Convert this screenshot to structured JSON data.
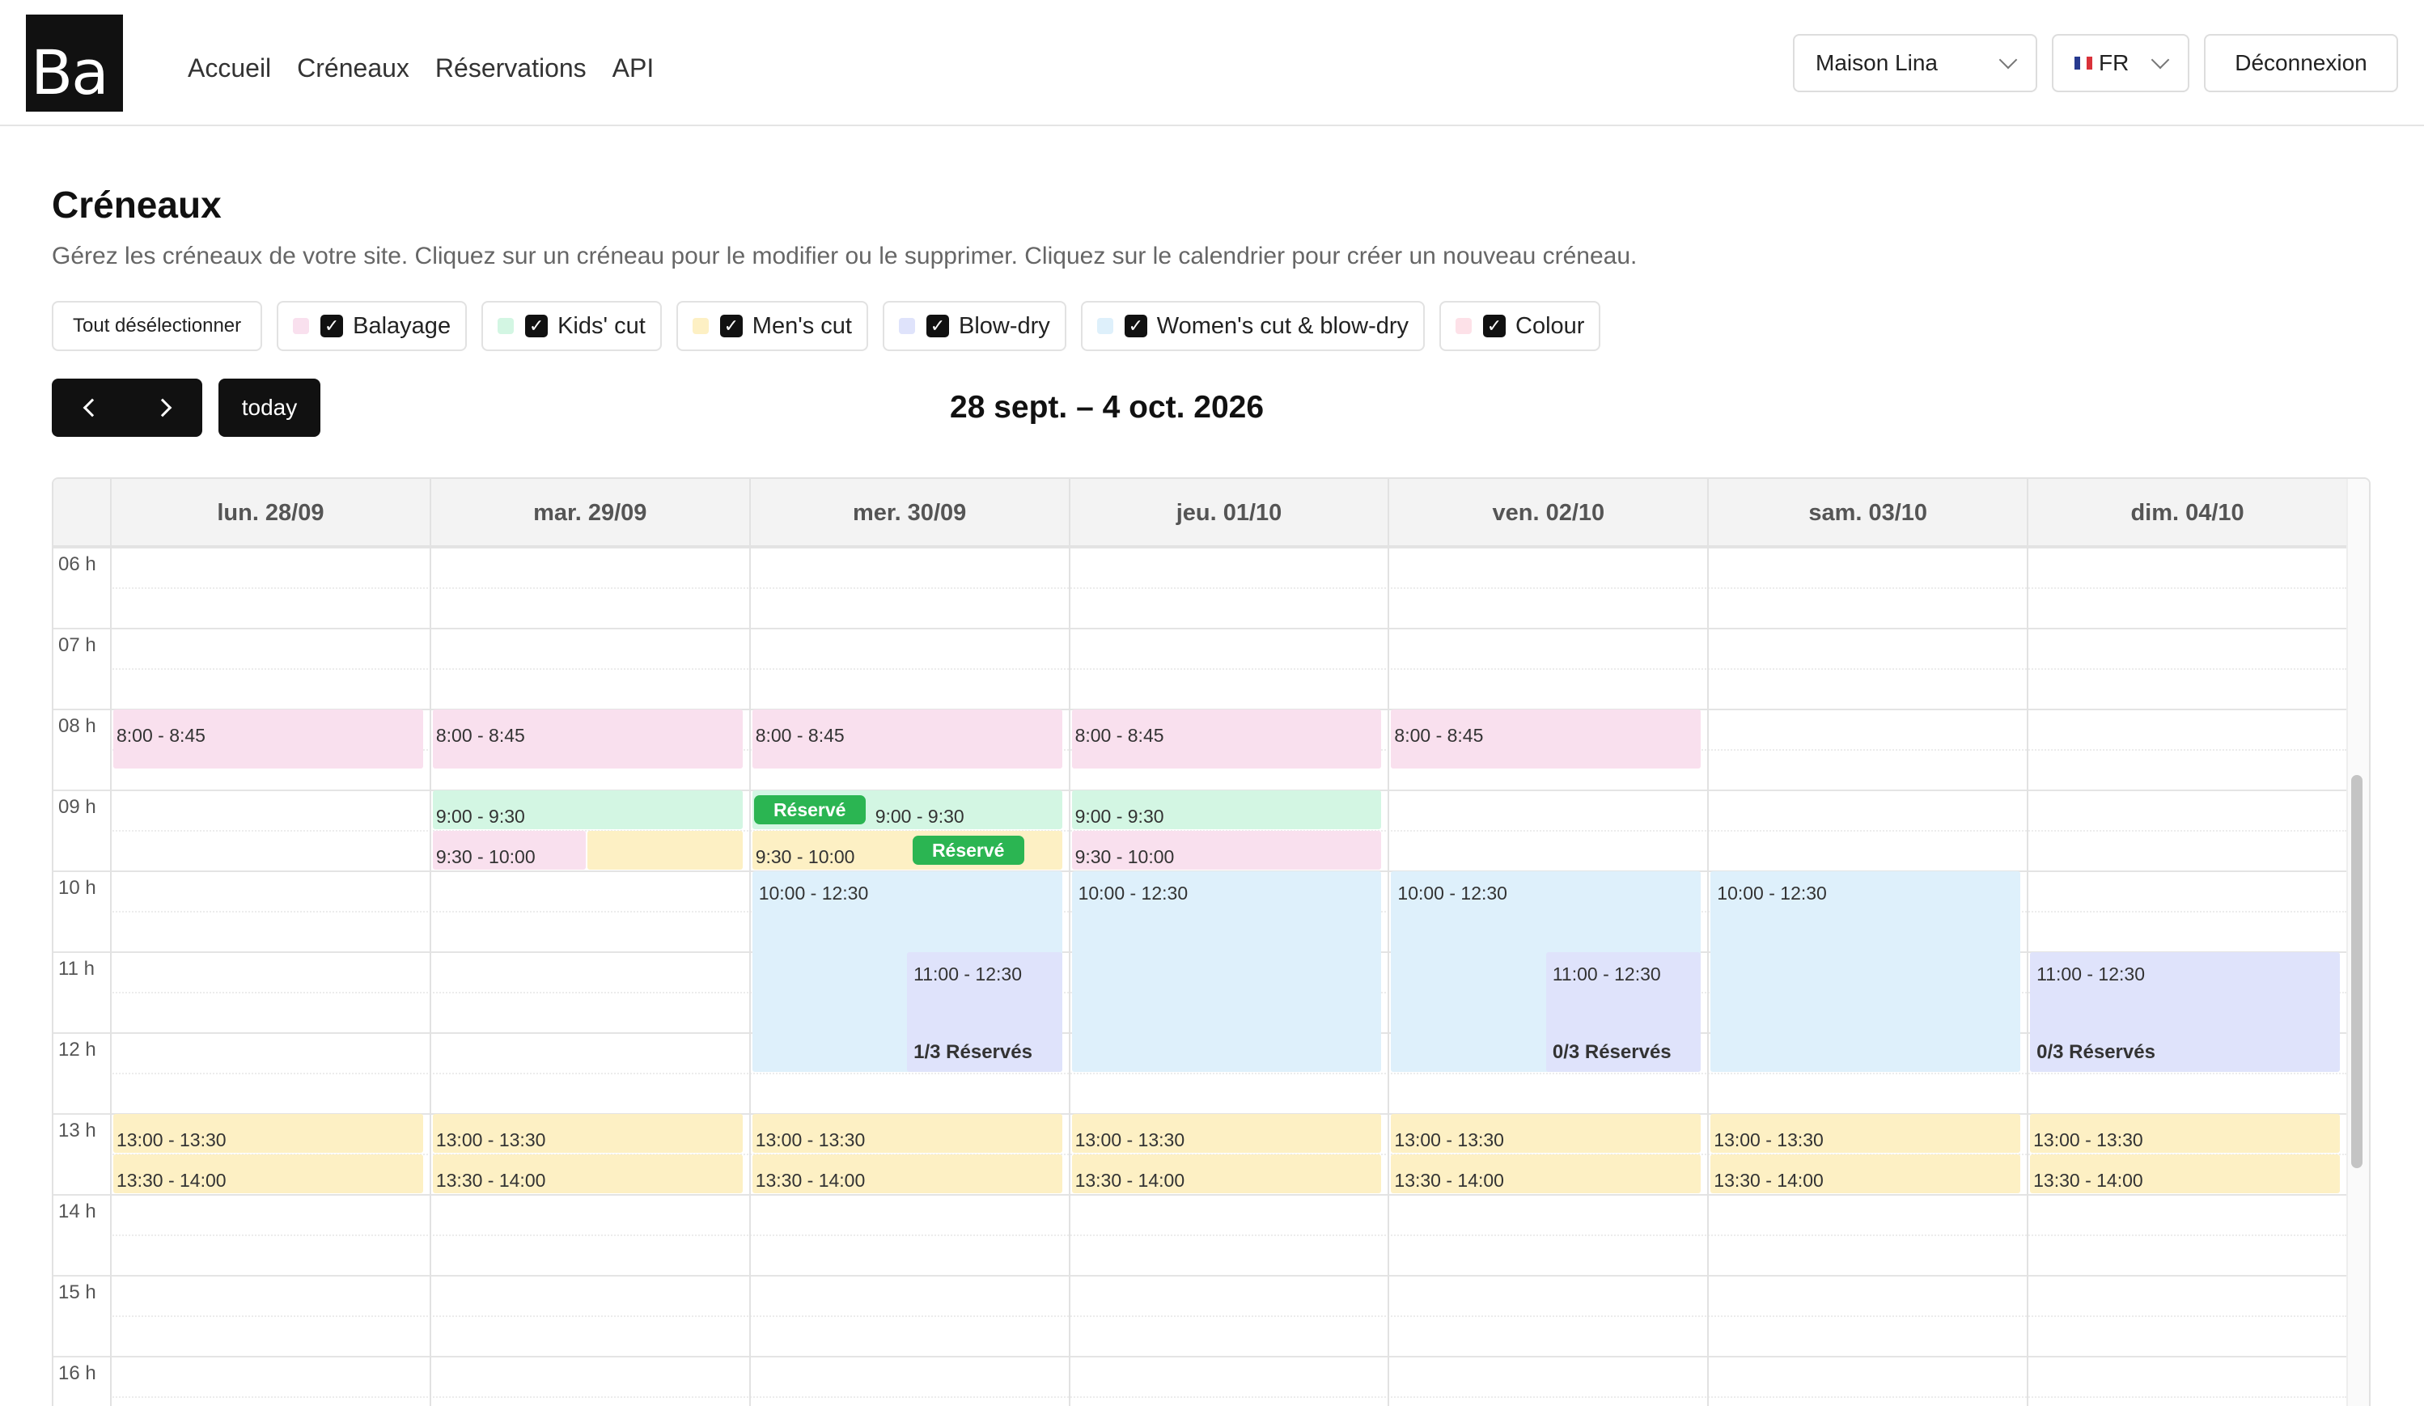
{
  "logo": "Ba",
  "nav": [
    "Accueil",
    "Créneaux",
    "Réservations",
    "API"
  ],
  "header": {
    "site_select": "Maison Lina",
    "lang_select": "FR",
    "logout": "Déconnexion"
  },
  "page": {
    "title": "Créneaux",
    "description": "Gérez les créneaux de votre site. Cliquez sur un créneau pour le modifier ou le supprimer. Cliquez sur le calendrier pour créer un nouveau créneau."
  },
  "filters": {
    "deselect_all": "Tout désélectionner",
    "items": [
      {
        "label": "Balayage",
        "color": "#f9e0ee",
        "checked": true
      },
      {
        "label": "Kids' cut",
        "color": "#d3f6e3",
        "checked": true
      },
      {
        "label": "Men's cut",
        "color": "#fdf0c4",
        "checked": true
      },
      {
        "label": "Blow-dry",
        "color": "#dfe3fb",
        "checked": true
      },
      {
        "label": "Women's cut & blow-dry",
        "color": "#def0fb",
        "checked": true
      },
      {
        "label": "Colour",
        "color": "#fde1e8",
        "checked": true
      }
    ]
  },
  "toolbar": {
    "today": "today",
    "range": "28 sept. – 4 oct. 2026"
  },
  "calendar": {
    "days": [
      "lun. 28/09",
      "mar. 29/09",
      "mer. 30/09",
      "jeu. 01/10",
      "ven. 02/10",
      "sam. 03/10",
      "dim. 04/10"
    ],
    "hours": [
      "06 h",
      "07 h",
      "08 h",
      "09 h",
      "10 h",
      "11 h",
      "12 h",
      "13 h",
      "14 h",
      "15 h",
      "16 h"
    ],
    "events": [
      {
        "day": 0,
        "start": 8,
        "end": 8.75,
        "label": "8:00 - 8:45",
        "type": "balayage"
      },
      {
        "day": 1,
        "start": 8,
        "end": 8.75,
        "label": "8:00 - 8:45",
        "type": "balayage"
      },
      {
        "day": 2,
        "start": 8,
        "end": 8.75,
        "label": "8:00 - 8:45",
        "type": "balayage"
      },
      {
        "day": 3,
        "start": 8,
        "end": 8.75,
        "label": "8:00 - 8:45",
        "type": "balayage"
      },
      {
        "day": 4,
        "start": 8,
        "end": 8.75,
        "label": "8:00 - 8:45",
        "type": "balayage"
      },
      {
        "day": 1,
        "start": 9,
        "end": 9.5,
        "label": "9:00 - 9:30",
        "type": "kids"
      },
      {
        "day": 1,
        "start": 9.5,
        "end": 10,
        "label": "9:30 - 10:00",
        "type": "balayage",
        "col": 0,
        "cols": 2
      },
      {
        "day": 1,
        "start": 9.5,
        "end": 10,
        "label": "",
        "type": "mens",
        "col": 1,
        "cols": 2
      },
      {
        "day": 2,
        "start": 9,
        "end": 9.5,
        "label": "9:00 - 9:30",
        "type": "kids",
        "badge": "Réservé"
      },
      {
        "day": 2,
        "start": 9.5,
        "end": 10,
        "label": "9:30 - 10:00",
        "type": "mens",
        "badge": "Réservé"
      },
      {
        "day": 3,
        "start": 9,
        "end": 9.5,
        "label": "9:00 - 9:30",
        "type": "kids"
      },
      {
        "day": 3,
        "start": 9.5,
        "end": 10,
        "label": "9:30 - 10:00",
        "type": "balayage"
      },
      {
        "day": 2,
        "start": 10,
        "end": 12.5,
        "label": "10:00 - 12:30",
        "type": "women"
      },
      {
        "day": 2,
        "start": 11,
        "end": 12.5,
        "label": "11:00 - 12:30",
        "type": "blowdry",
        "col": 1,
        "cols": 2,
        "count": "1/3 Réservés"
      },
      {
        "day": 3,
        "start": 10,
        "end": 12.5,
        "label": "10:00 - 12:30",
        "type": "women"
      },
      {
        "day": 4,
        "start": 10,
        "end": 12.5,
        "label": "10:00 - 12:30",
        "type": "women"
      },
      {
        "day": 4,
        "start": 11,
        "end": 12.5,
        "label": "11:00 - 12:30",
        "type": "blowdry",
        "col": 1,
        "cols": 2,
        "count": "0/3 Réservés"
      },
      {
        "day": 5,
        "start": 10,
        "end": 12.5,
        "label": "10:00 - 12:30",
        "type": "women"
      },
      {
        "day": 6,
        "start": 11,
        "end": 12.5,
        "label": "11:00 - 12:30",
        "type": "blowdry",
        "count": "0/3 Réservés"
      },
      {
        "day": 0,
        "start": 13,
        "end": 13.5,
        "label": "13:00 - 13:30",
        "type": "mens"
      },
      {
        "day": 0,
        "start": 13.5,
        "end": 14,
        "label": "13:30 - 14:00",
        "type": "mens"
      },
      {
        "day": 1,
        "start": 13,
        "end": 13.5,
        "label": "13:00 - 13:30",
        "type": "mens"
      },
      {
        "day": 1,
        "start": 13.5,
        "end": 14,
        "label": "13:30 - 14:00",
        "type": "mens"
      },
      {
        "day": 2,
        "start": 13,
        "end": 13.5,
        "label": "13:00 - 13:30",
        "type": "mens"
      },
      {
        "day": 2,
        "start": 13.5,
        "end": 14,
        "label": "13:30 - 14:00",
        "type": "mens"
      },
      {
        "day": 3,
        "start": 13,
        "end": 13.5,
        "label": "13:00 - 13:30",
        "type": "mens"
      },
      {
        "day": 3,
        "start": 13.5,
        "end": 14,
        "label": "13:30 - 14:00",
        "type": "mens"
      },
      {
        "day": 4,
        "start": 13,
        "end": 13.5,
        "label": "13:00 - 13:30",
        "type": "mens"
      },
      {
        "day": 4,
        "start": 13.5,
        "end": 14,
        "label": "13:30 - 14:00",
        "type": "mens"
      },
      {
        "day": 5,
        "start": 13,
        "end": 13.5,
        "label": "13:00 - 13:30",
        "type": "mens"
      },
      {
        "day": 5,
        "start": 13.5,
        "end": 14,
        "label": "13:30 - 14:00",
        "type": "mens"
      },
      {
        "day": 6,
        "start": 13,
        "end": 13.5,
        "label": "13:00 - 13:30",
        "type": "mens"
      },
      {
        "day": 6,
        "start": 13.5,
        "end": 14,
        "label": "13:30 - 14:00",
        "type": "mens"
      }
    ]
  },
  "colors": {
    "balayage": "#f9e0ee",
    "kids": "#d3f6e3",
    "mens": "#fdf0c4",
    "blowdry": "#dfe3fb",
    "women": "#def0fb",
    "badge": "#2bb552"
  }
}
